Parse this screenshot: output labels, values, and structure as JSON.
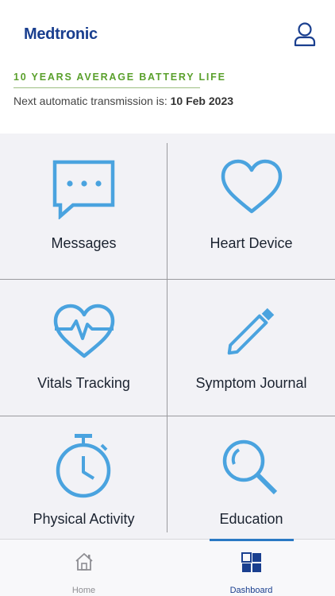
{
  "header": {
    "logo": "Medtronic",
    "battery_text": "10 YEARS AVERAGE BATTERY LIFE",
    "transmission_prefix": "Next automatic transmission is: ",
    "transmission_date": "10 Feb 2023"
  },
  "tiles": [
    {
      "label": "Messages",
      "icon": "message-icon"
    },
    {
      "label": "Heart Device",
      "icon": "heart-icon"
    },
    {
      "label": "Vitals Tracking",
      "icon": "heart-pulse-icon"
    },
    {
      "label": "Symptom Journal",
      "icon": "pencil-icon"
    },
    {
      "label": "Physical Activity",
      "icon": "stopwatch-icon"
    },
    {
      "label": "Education",
      "icon": "magnifier-icon"
    }
  ],
  "tabbar": {
    "home": {
      "label": "Home",
      "icon": "home-icon"
    },
    "dashboard": {
      "label": "Dashboard",
      "icon": "dashboard-grid-icon",
      "selected": true
    }
  },
  "colors": {
    "brand": "#1a3f8f",
    "accent": "#4aa3df",
    "battery_green": "#5aa02c"
  }
}
